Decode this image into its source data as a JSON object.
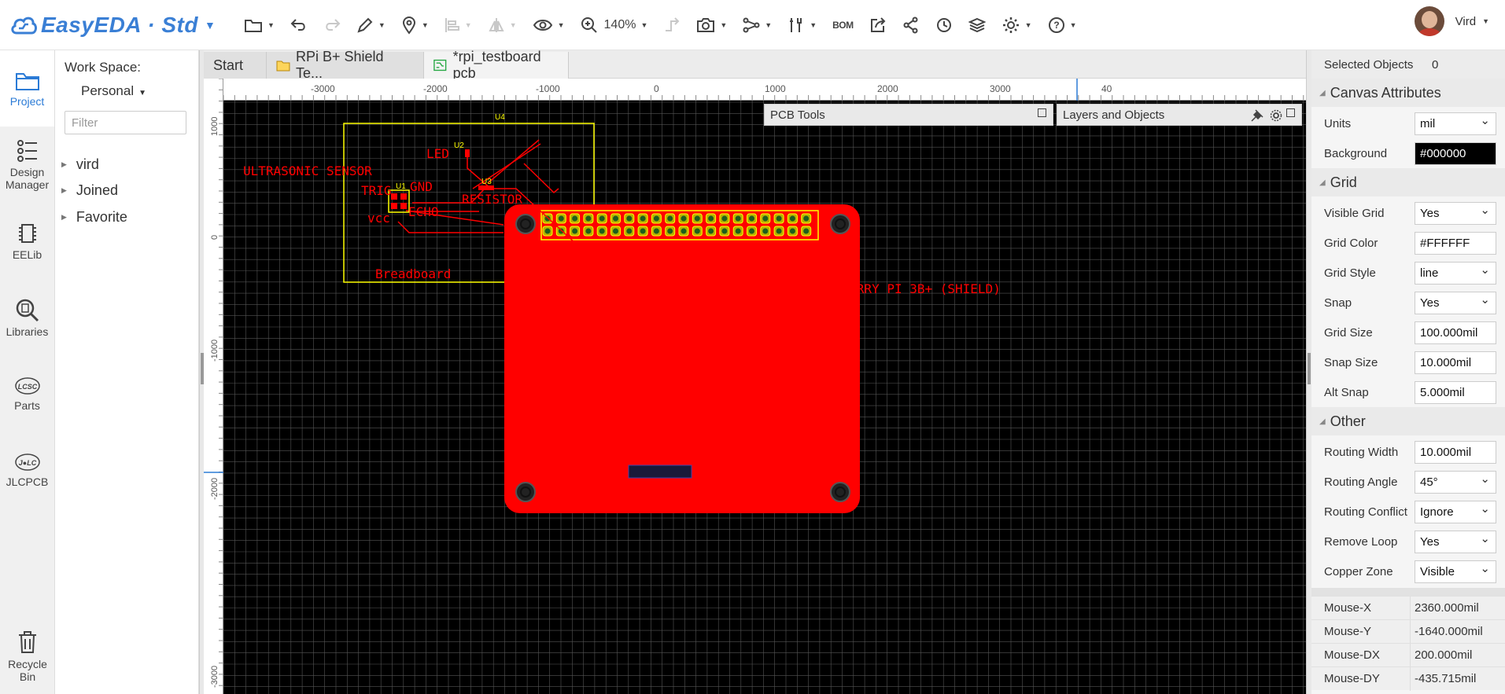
{
  "app": {
    "brand": "EasyEDA · Std"
  },
  "toolbar": {
    "zoom": "140%",
    "bom": "BOM"
  },
  "user": {
    "name": "Vird"
  },
  "nav": [
    {
      "label": "Project",
      "icon": "folder-icon"
    },
    {
      "label": "Design Manager",
      "icon": "design-manager-icon"
    },
    {
      "label": "EELib",
      "icon": "chip-icon"
    },
    {
      "label": "Libraries",
      "icon": "library-search-icon"
    },
    {
      "label": "Parts",
      "icon": "lcsc-icon"
    },
    {
      "label": "JLCPCB",
      "icon": "jlc-icon"
    }
  ],
  "recycle": {
    "label": "Recycle Bin"
  },
  "workspace": {
    "label": "Work Space:",
    "value": "Personal",
    "filter_placeholder": "Filter"
  },
  "tree": [
    "vird",
    "Joined",
    "Favorite"
  ],
  "tabs": [
    "Start",
    "RPi B+ Shield Te...",
    "*rpi_testboard pcb"
  ],
  "ruler": {
    "h": [
      "-3000",
      "-2000",
      "-1000",
      "0",
      "1000",
      "2000",
      "3000",
      "40"
    ],
    "v": [
      "1000",
      "0",
      "-1000",
      "-2000",
      "-3000"
    ]
  },
  "floating": {
    "pcb_tools": "PCB Tools",
    "layers": "Layers and Objects"
  },
  "board": {
    "labels": {
      "ultrasonic": "ULTRASONIC SENSOR",
      "trig": "TRIG",
      "gnd": "GND",
      "echo": "ECHO",
      "vcc": "vcc",
      "led": "LED",
      "resistor": "RESISTOR",
      "breadboard": "Breadboard",
      "rpi": "RASPBERRY PI 3B+ (SHIELD)",
      "u1": "U1",
      "u2": "U2",
      "u3": "U3",
      "u4": "U4"
    },
    "colors": {
      "board": "#ff0000",
      "silk": "#ffff00",
      "grid": "#ffffff",
      "background": "#000000"
    }
  },
  "props": {
    "selected_label": "Selected Objects",
    "selected_count": "0",
    "canvas_title": "Canvas Attributes",
    "units_label": "Units",
    "units": "mil",
    "background_label": "Background",
    "background": "#000000",
    "grid_title": "Grid",
    "visible_grid_label": "Visible Grid",
    "visible_grid": "Yes",
    "grid_color_label": "Grid Color",
    "grid_color": "#FFFFFF",
    "grid_style_label": "Grid Style",
    "grid_style": "line",
    "snap_label": "Snap",
    "snap": "Yes",
    "grid_size_label": "Grid Size",
    "grid_size": "100.000mil",
    "snap_size_label": "Snap Size",
    "snap_size": "10.000mil",
    "alt_snap_label": "Alt Snap",
    "alt_snap": "5.000mil",
    "other_title": "Other",
    "routing_width_label": "Routing Width",
    "routing_width": "10.000mil",
    "routing_angle_label": "Routing Angle",
    "routing_angle": "45°",
    "routing_conflict_label": "Routing Conflict",
    "routing_conflict": "Ignore",
    "remove_loop_label": "Remove Loop",
    "remove_loop": "Yes",
    "copper_zone_label": "Copper Zone",
    "copper_zone": "Visible"
  },
  "mouse": {
    "x_label": "Mouse-X",
    "x": "2360.000mil",
    "y_label": "Mouse-Y",
    "y": "-1640.000mil",
    "dx_label": "Mouse-DX",
    "dx": "200.000mil",
    "dy_label": "Mouse-DY",
    "dy": "-435.715mil"
  }
}
